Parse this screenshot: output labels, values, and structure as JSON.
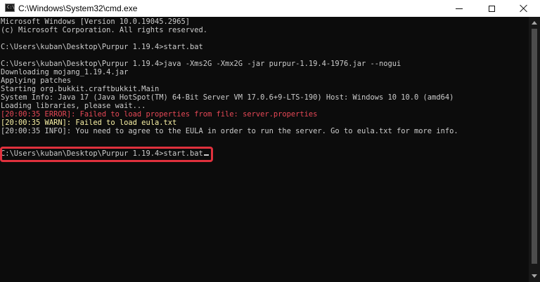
{
  "window": {
    "title": "C:\\Windows\\System32\\cmd.exe",
    "icon_text": "C:\\"
  },
  "console": {
    "lines": [
      {
        "text": "Microsoft Windows [Version 10.0.19045.2965]",
        "style": "plain"
      },
      {
        "text": "(c) Microsoft Corporation. All rights reserved.",
        "style": "plain"
      },
      {
        "text": "",
        "style": "plain"
      },
      {
        "text": "C:\\Users\\kuban\\Desktop\\Purpur 1.19.4>start.bat",
        "style": "plain"
      },
      {
        "text": "",
        "style": "plain"
      },
      {
        "text": "C:\\Users\\kuban\\Desktop\\Purpur 1.19.4>java -Xms2G -Xmx2G -jar purpur-1.19.4-1976.jar --nogui",
        "style": "plain"
      },
      {
        "text": "Downloading mojang_1.19.4.jar",
        "style": "plain"
      },
      {
        "text": "Applying patches",
        "style": "plain"
      },
      {
        "text": "Starting org.bukkit.craftbukkit.Main",
        "style": "plain"
      },
      {
        "text": "System Info: Java 17 (Java HotSpot(TM) 64-Bit Server VM 17.0.6+9-LTS-190) Host: Windows 10 10.0 (amd64)",
        "style": "plain"
      },
      {
        "text": "Loading libraries, please wait...",
        "style": "plain"
      },
      {
        "text": "[20:00:35 ERROR]: Failed to load properties from file: server.properties",
        "style": "red"
      },
      {
        "text": "[20:00:35 WARN]: Failed to load eula.txt",
        "style": "yellow"
      },
      {
        "text": "[20:00:35 INFO]: You need to agree to the EULA in order to run the server. Go to eula.txt for more info.",
        "style": "plain"
      },
      {
        "text": "",
        "style": "plain"
      }
    ],
    "prompt_line": "C:\\Users\\kuban\\Desktop\\Purpur 1.19.4>start.bat"
  },
  "colors": {
    "background": "#0c0c0c",
    "text": "#cccccc",
    "error": "#e74856",
    "warn": "#f9f1a5",
    "highlight": "#e0313d"
  },
  "icons": {
    "minimize": "minimize-icon",
    "maximize": "maximize-icon",
    "close": "close-icon"
  }
}
